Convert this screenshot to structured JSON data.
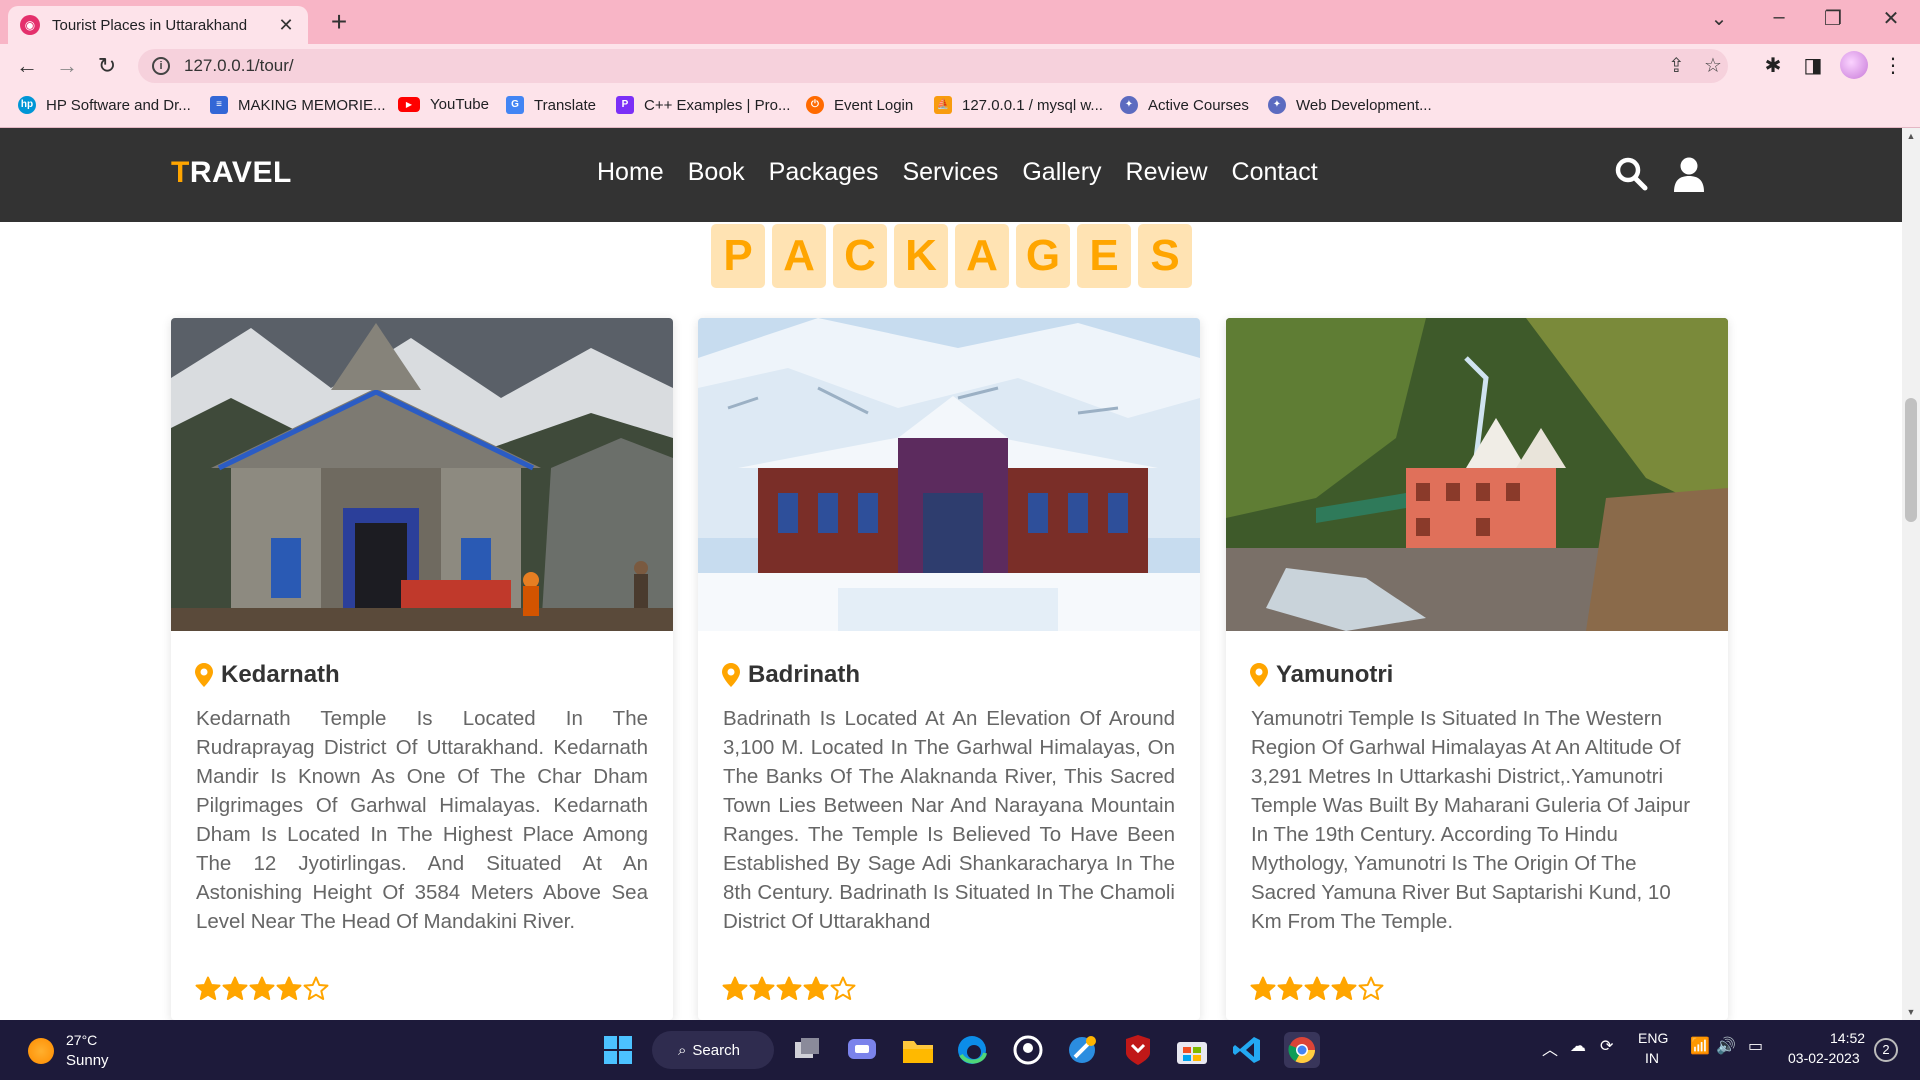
{
  "browser": {
    "tab_title": "Tourist Places in Uttarakhand",
    "url": "127.0.0.1/tour/",
    "bookmarks": [
      {
        "label": "HP Software and Dr..."
      },
      {
        "label": "MAKING MEMORIE..."
      },
      {
        "label": "YouTube"
      },
      {
        "label": "Translate"
      },
      {
        "label": "C++ Examples | Pro..."
      },
      {
        "label": "Event Login"
      },
      {
        "label": "127.0.0.1 / mysql w..."
      },
      {
        "label": "Active Courses"
      },
      {
        "label": "Web Development..."
      }
    ]
  },
  "site": {
    "logo_first": "T",
    "logo_rest": "RAVEL",
    "accent_color": "#ffa500",
    "header_bg": "#333333",
    "nav": [
      "Home",
      "Book",
      "Packages",
      "Services",
      "Gallery",
      "Review",
      "Contact"
    ]
  },
  "heading": {
    "letters": [
      "P",
      "A",
      "C",
      "K",
      "A",
      "G",
      "E",
      "S"
    ]
  },
  "packages": [
    {
      "title": "Kedarnath",
      "description": "Kedarnath Temple Is Located In The Rudraprayag District Of Uttarakhand. Kedarnath Mandir Is Known As One Of The Char Dham Pilgrimages Of Garhwal Himalayas. Kedarnath Dham Is Located In The Highest Place Among The 12 Jyotirlingas. And Situated At An Astonishing Height Of 3584 Meters Above Sea Level Near The Head Of Mandakini River.",
      "rating": 4,
      "rating_max": 5
    },
    {
      "title": "Badrinath",
      "description": "Badrinath Is Located At An Elevation Of Around 3,100 M. Located In The Garhwal Himalayas, On The Banks Of The Alaknanda River, This Sacred Town Lies Between Nar And Narayana Mountain Ranges. The Temple Is Believed To Have Been Established By Sage Adi Shankaracharya In The 8th Century. Badrinath Is Situated In The Chamoli District Of Uttarakhand",
      "rating": 4,
      "rating_max": 5
    },
    {
      "title": "Yamunotri",
      "description": "Yamunotri Temple Is Situated In The Western Region Of Garhwal Himalayas At An Altitude Of 3,291 Metres In Uttarkashi District,.Yamunotri Temple Was Built By Maharani Guleria Of Jaipur In The 19th Century. According To Hindu Mythology, Yamunotri Is The Origin Of The Sacred Yamuna River But Saptarishi Kund, 10 Km From The Temple.",
      "rating": 4,
      "rating_max": 5
    }
  ],
  "taskbar": {
    "temperature": "27°C",
    "condition": "Sunny",
    "search_label": "Search",
    "lang_1": "ENG",
    "lang_2": "IN",
    "time": "14:52",
    "date": "03-02-2023",
    "notifications": "2"
  }
}
